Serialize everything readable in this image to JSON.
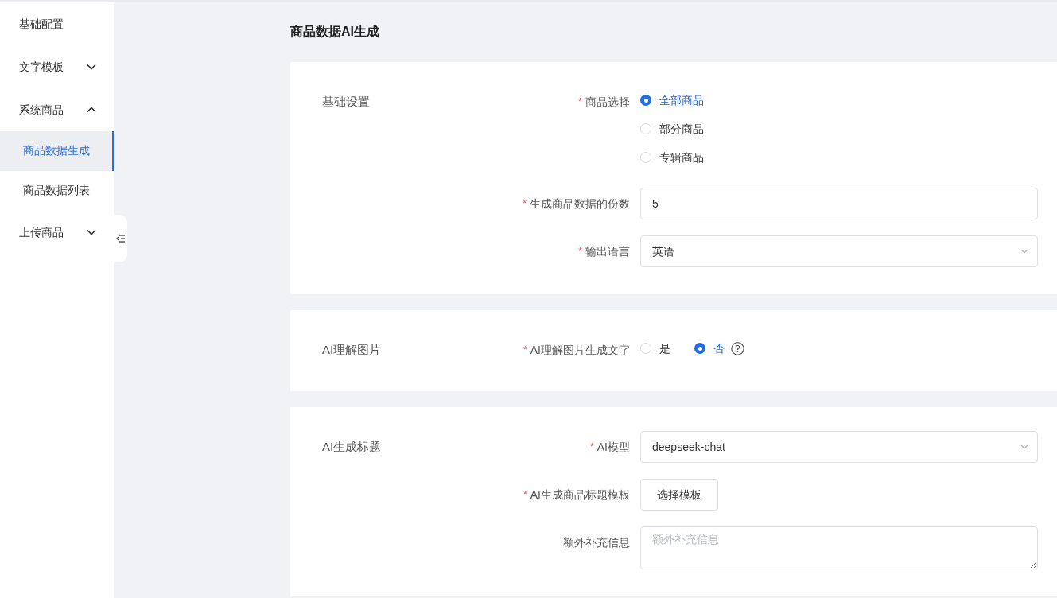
{
  "sidebar": {
    "items": [
      {
        "label": "基础配置",
        "kind": "item",
        "selected": false
      },
      {
        "label": "文字模板",
        "kind": "group",
        "expanded": false
      },
      {
        "label": "系统商品",
        "kind": "group",
        "expanded": true,
        "children": [
          {
            "label": "商品数据生成",
            "kind": "item",
            "selected": true
          },
          {
            "label": "商品数据列表",
            "kind": "item",
            "selected": false
          }
        ]
      },
      {
        "label": "上传商品",
        "kind": "group",
        "expanded": false
      }
    ]
  },
  "page": {
    "title": "商品数据AI生成"
  },
  "sections": [
    {
      "title": "基础设置",
      "fields": [
        {
          "label": "商品选择",
          "required_mark": "*",
          "kind": "radio",
          "options": [
            {
              "label": "全部商品",
              "selected": true
            },
            {
              "label": "部分商品",
              "selected": false
            },
            {
              "label": "专辑商品",
              "selected": false
            }
          ]
        },
        {
          "label": "生成商品数据的份数",
          "required_mark": "*",
          "kind": "input",
          "value": "5"
        },
        {
          "label": "输出语言",
          "required_mark": "*",
          "kind": "select",
          "value": "英语"
        }
      ]
    },
    {
      "title": "AI理解图片",
      "fields": [
        {
          "label": "AI理解图片生成文字",
          "required_mark": "*",
          "kind": "radio-inline",
          "help": true,
          "options": [
            {
              "label": "是",
              "selected": false
            },
            {
              "label": "否",
              "selected": true
            }
          ]
        }
      ]
    },
    {
      "title": "AI生成标题",
      "fields": [
        {
          "label": "AI模型",
          "required_mark": "*",
          "kind": "select",
          "value": "deepseek-chat"
        },
        {
          "label": "AI生成商品标题模板",
          "required_mark": "*",
          "kind": "button",
          "value": "选择模板"
        },
        {
          "label": "额外补充信息",
          "kind": "textarea",
          "placeholder": "额外补充信息"
        }
      ]
    }
  ]
}
